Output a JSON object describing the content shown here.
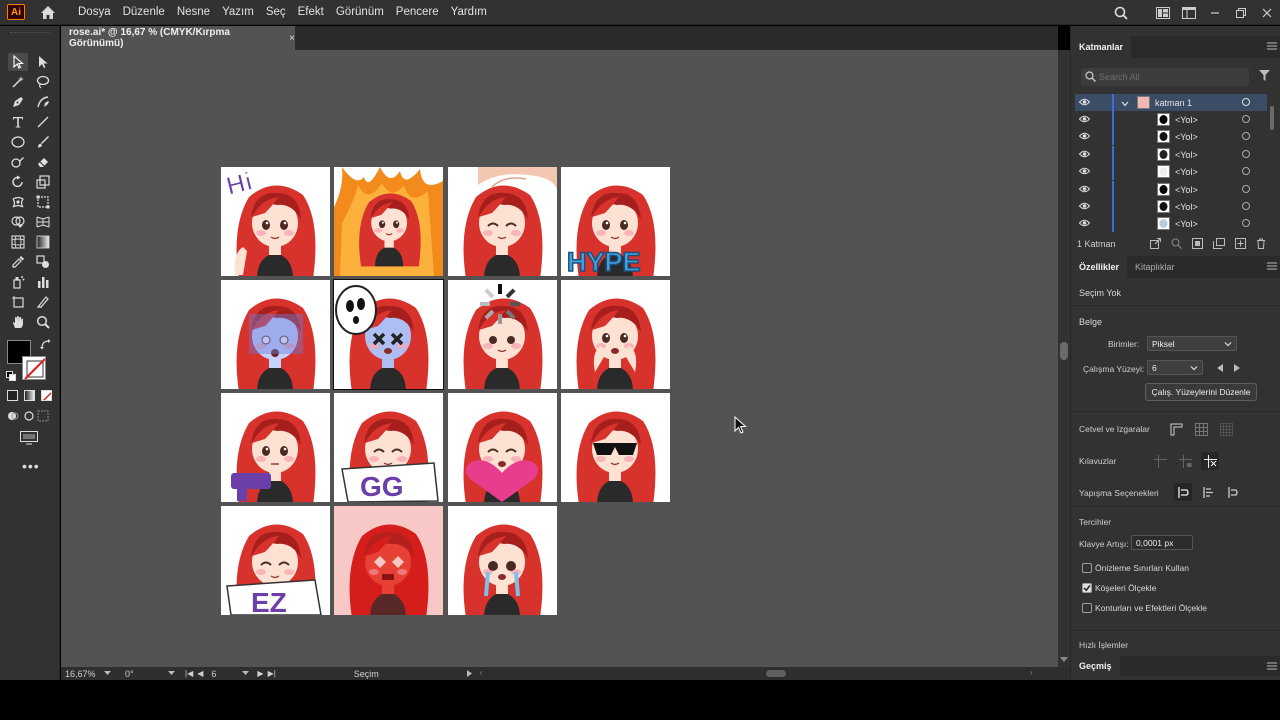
{
  "app": {
    "logo_text": "Ai",
    "menu": [
      "Dosya",
      "Düzenle",
      "Nesne",
      "Yazım",
      "Seç",
      "Efekt",
      "Görünüm",
      "Pencere",
      "Yardım"
    ]
  },
  "document": {
    "tab_title": "rose.ai* @ 16,67 % (CMYK/Kırpma Görünümü)",
    "close_symbol": "×"
  },
  "artboards": [
    {
      "name": "Hi",
      "caption": "Hi"
    },
    {
      "name": "Rage",
      "caption": ""
    },
    {
      "name": "Headpat",
      "caption": ""
    },
    {
      "name": "Hype",
      "caption": "HYPE"
    },
    {
      "name": "Scared",
      "caption": ""
    },
    {
      "name": "Dead",
      "caption": ""
    },
    {
      "name": "Loading",
      "caption": ""
    },
    {
      "name": "Blush",
      "caption": ""
    },
    {
      "name": "Gun",
      "caption": ""
    },
    {
      "name": "GG",
      "caption": "GG"
    },
    {
      "name": "Love",
      "caption": ""
    },
    {
      "name": "Cool",
      "caption": ""
    },
    {
      "name": "EZ",
      "caption": "EZ"
    },
    {
      "name": "Angry",
      "caption": ""
    },
    {
      "name": "Cry",
      "caption": ""
    }
  ],
  "statusbar": {
    "zoom": "16,67%",
    "rotation": "0°",
    "artboard_number": "6",
    "tool_name": "Seçim"
  },
  "layers_panel": {
    "tab": "Katmanlar",
    "search_placeholder": "Search All",
    "layer_name": "katman 1",
    "sublayers": [
      "<Yol>",
      "<Yol>",
      "<Yol>",
      "<Yol>",
      "<Yol>",
      "<Yol>",
      "<Yol>"
    ],
    "footer_count": "1 Katman"
  },
  "properties_panel": {
    "tabs": [
      "Özellikler",
      "Kitaplıklar"
    ],
    "selection_status": "Seçim Yok",
    "section_document": "Belge",
    "units_label": "Birimler:",
    "units_value": "Piksel",
    "artboard_label": "Çalışma Yüzeyi:",
    "artboard_value": "6",
    "edit_artboards_button": "Çalış. Yüzeylerini Düzenle",
    "rulers_grids": "Cetvel ve Izgaralar",
    "guides": "Kılavuzlar",
    "snap_options": "Yapışma Seçenekleri",
    "preferences": "Tercihler",
    "keyboard_increment_label": "Klavye Artışı:",
    "keyboard_increment_value": "0,0001 px",
    "checkboxes": [
      {
        "label": "Önizleme Sınırları Kullan",
        "checked": false
      },
      {
        "label": "Köşeleri Ölçekle",
        "checked": true
      },
      {
        "label": "Konturları ve Efektleri Ölçekle",
        "checked": false
      }
    ],
    "quick_actions": "Hızlı İşlemler"
  },
  "history_panel": {
    "tab": "Geçmiş"
  },
  "colors": {
    "hair": "#d8322c",
    "hair_dark": "#a71f1d",
    "skin": "#fde2d4",
    "accent_purple": "#6b3fa8",
    "accent_blue": "#3fa4e0"
  }
}
